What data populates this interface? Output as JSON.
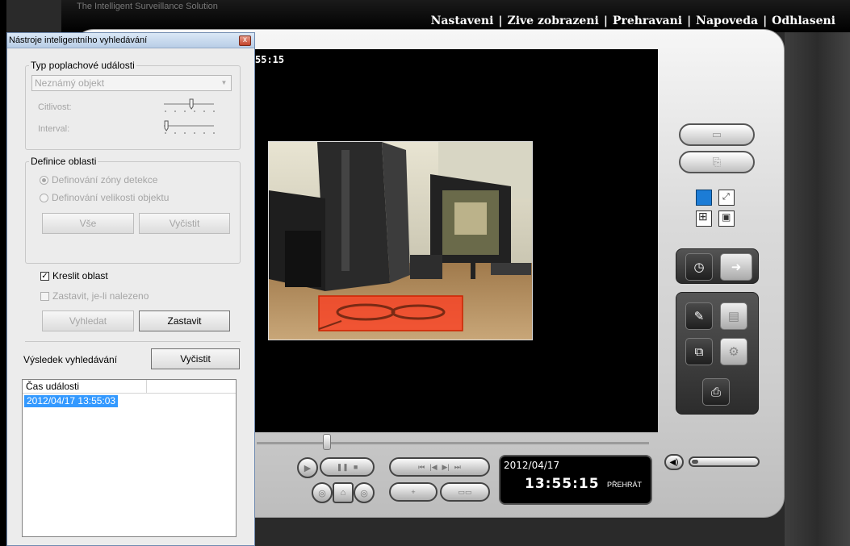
{
  "app": {
    "tagline": "The Intelligent Surveillance Solution",
    "nav": [
      "Nastaveni",
      "Zive zobrazeni",
      "Prehravani",
      "Napoveda",
      "Odhlaseni"
    ],
    "nav_separator": "|"
  },
  "video": {
    "overlay_timestamp": "55:15"
  },
  "dialog": {
    "title": "Nástroje inteligentního vyhledávání",
    "close_glyph": "x",
    "event_group": {
      "legend": "Typ poplachové události",
      "event_type_value": "Neznámý objekt",
      "sensitivity_label": "Citlivost:",
      "interval_label": "Interval:",
      "sensitivity_level": 0.55,
      "interval_level": 0.05
    },
    "area_group": {
      "legend": "Definice oblasti",
      "radio_zone": "Definování zóny detekce",
      "radio_size": "Definování velikosti objektu",
      "btn_all": "Vše",
      "btn_clear": "Vyčistit"
    },
    "draw_area_label": "Kreslit oblast",
    "draw_area_checked": true,
    "stop_when_found_label": "Zastavit, je-li nalezeno",
    "stop_when_found_checked": false,
    "btn_search": "Vyhledat",
    "btn_stop": "Zastavit",
    "results_label": "Výsledek vyhledávání",
    "btn_results_clear": "Vyčistit",
    "results_columns": [
      "Čas události",
      ""
    ],
    "results": [
      "2012/04/17  13:55:03"
    ]
  },
  "playback": {
    "date": "2012/04/17",
    "time": "13:55:15",
    "state": "PŘEHRÁT",
    "volume_level": 0.1
  },
  "icons": {
    "play": "▶",
    "pause": "❚❚",
    "stop": "■",
    "first": "⏮",
    "prev": "|◀",
    "next": "▶|",
    "last": "⏭",
    "snapshot": "⌂",
    "volume": "◀)",
    "pencil": "✎",
    "clock": "◷",
    "print": "⎙"
  },
  "colors": {
    "accent": "#3399ff",
    "roi": "#ff3b1f"
  }
}
